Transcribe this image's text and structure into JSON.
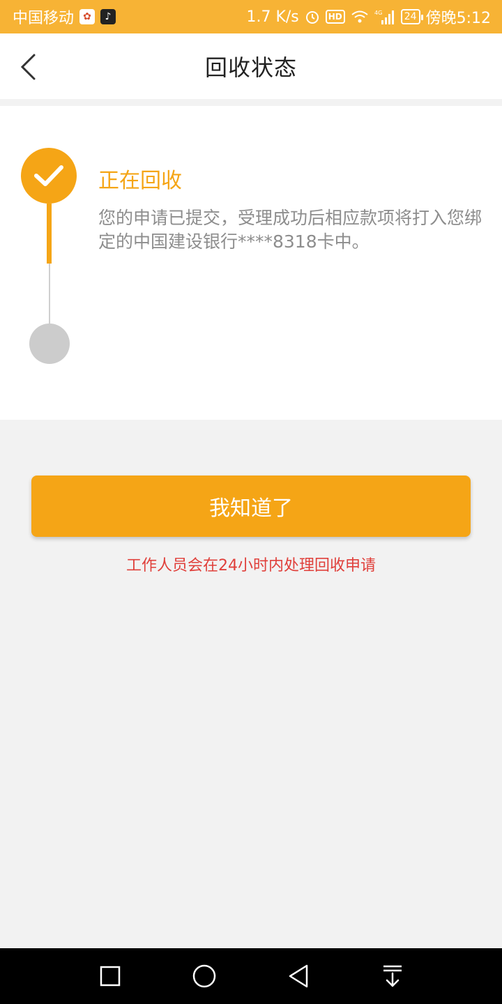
{
  "status_bar": {
    "carrier": "中国移动",
    "speed": "1.7 K/s",
    "hd": "HD",
    "network": "4G",
    "battery": "24",
    "time": "傍晚5:12"
  },
  "header": {
    "title": "回收状态"
  },
  "progress": {
    "step1_title": "正在回收",
    "step1_desc": "您的申请已提交，受理成功后相应款项将打入您绑定的中国建设银行****8318卡中。"
  },
  "actions": {
    "confirm_label": "我知道了",
    "notice": "工作人员会在24小时内处理回收申请"
  },
  "colors": {
    "accent": "#f5a516",
    "notice": "#e0403b",
    "pending": "#cccccc"
  }
}
